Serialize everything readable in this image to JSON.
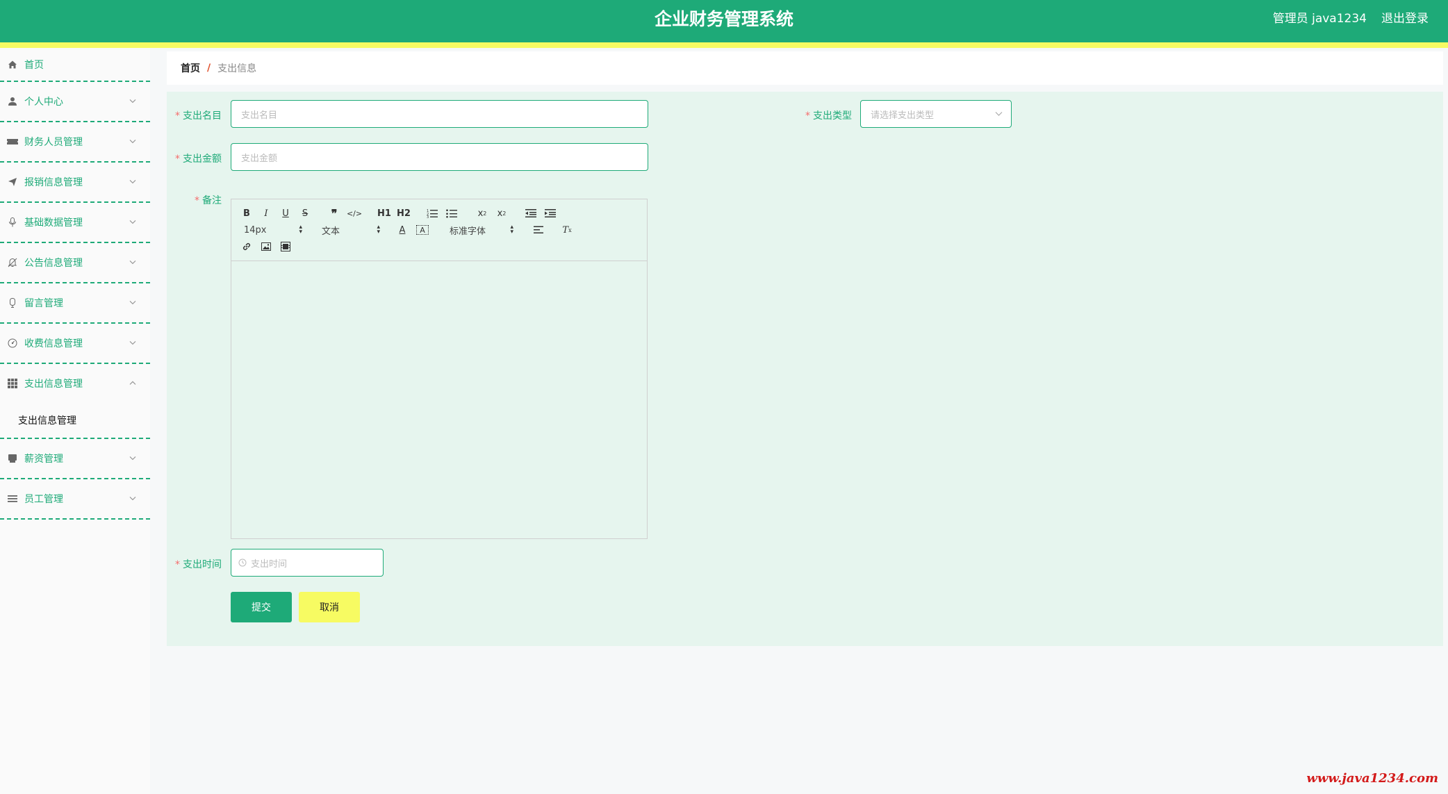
{
  "header": {
    "title": "企业财务管理系统",
    "user": "管理员 java1234",
    "logout": "退出登录"
  },
  "sidebar": {
    "items": [
      {
        "label": "首页",
        "icon": "home-icon",
        "has_arrow": false
      },
      {
        "label": "个人中心",
        "icon": "user-icon",
        "has_arrow": true
      },
      {
        "label": "财务人员管理",
        "icon": "ticket-icon",
        "has_arrow": true
      },
      {
        "label": "报销信息管理",
        "icon": "send-icon",
        "has_arrow": true
      },
      {
        "label": "基础数据管理",
        "icon": "microphone-icon",
        "has_arrow": true
      },
      {
        "label": "公告信息管理",
        "icon": "bell-off-icon",
        "has_arrow": true
      },
      {
        "label": "留言管理",
        "icon": "mic-icon",
        "has_arrow": true
      },
      {
        "label": "收费信息管理",
        "icon": "gauge-icon",
        "has_arrow": true
      },
      {
        "label": "支出信息管理",
        "icon": "grid-icon",
        "has_arrow": true,
        "expanded": true
      },
      {
        "label": "薪资管理",
        "icon": "printer-icon",
        "has_arrow": true
      },
      {
        "label": "员工管理",
        "icon": "list-icon",
        "has_arrow": true
      }
    ],
    "submenu": {
      "label": "支出信息管理"
    }
  },
  "breadcrumb": {
    "home": "首页",
    "separator": "/",
    "current": "支出信息"
  },
  "form": {
    "name": {
      "label": "支出名目",
      "placeholder": "支出名目"
    },
    "type": {
      "label": "支出类型",
      "placeholder": "请选择支出类型"
    },
    "amount": {
      "label": "支出金额",
      "placeholder": "支出金额"
    },
    "remark": {
      "label": "备注"
    },
    "time": {
      "label": "支出时间",
      "placeholder": "支出时间"
    },
    "required_mark": "*"
  },
  "editor": {
    "font_size": "14px",
    "format": "文本",
    "font_family": "标准字体",
    "h1": "H1",
    "h2": "H2"
  },
  "buttons": {
    "submit": "提交",
    "cancel": "取消"
  },
  "watermark": "www.java1234.com",
  "colors": {
    "primary": "#1eaa78",
    "accent": "#f7fb62",
    "required": "#f56c6c",
    "panel_bg": "#e6f5ee"
  }
}
